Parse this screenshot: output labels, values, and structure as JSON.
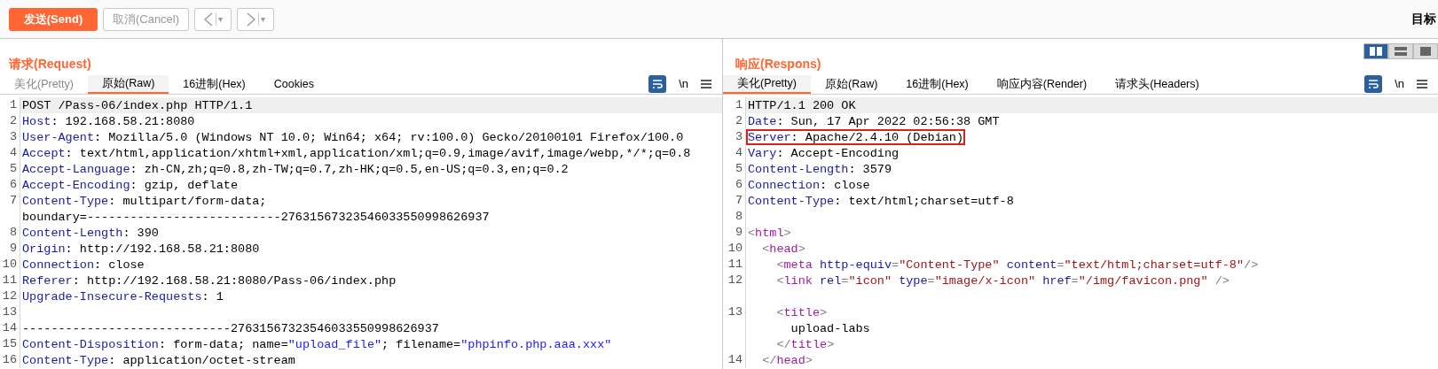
{
  "toolbar": {
    "send": "发送(Send)",
    "cancel": "取消(Cancel)",
    "back_caret": "▾",
    "forward_caret": "▾",
    "target": "目标"
  },
  "request": {
    "title": "请求(Request)",
    "tabs": [
      {
        "label": "美化(Pretty)",
        "selected": false,
        "disabled": true
      },
      {
        "label": "原始(Raw)",
        "selected": true,
        "disabled": false
      },
      {
        "label": "16进制(Hex)",
        "selected": false,
        "disabled": false
      },
      {
        "label": "Cookies",
        "selected": false,
        "disabled": false
      }
    ],
    "newline_toggle": "\\n",
    "lines": [
      {
        "number": "1",
        "current": true,
        "segments": [
          {
            "kind": "plain",
            "text": "POST /Pass-06/index.php HTTP/1.1"
          }
        ]
      },
      {
        "number": "2",
        "current": false,
        "segments": [
          {
            "kind": "key",
            "text": "Host"
          },
          {
            "kind": "plain",
            "text": ": 192.168.58.21:8080"
          }
        ]
      },
      {
        "number": "3",
        "current": false,
        "segments": [
          {
            "kind": "key",
            "text": "User-Agent"
          },
          {
            "kind": "plain",
            "text": ": Mozilla/5.0 (Windows NT 10.0; Win64; x64; rv:100.0) Gecko/20100101 Firefox/100.0"
          }
        ]
      },
      {
        "number": "4",
        "current": false,
        "segments": [
          {
            "kind": "key",
            "text": "Accept"
          },
          {
            "kind": "plain",
            "text": ": text/html,application/xhtml+xml,application/xml;q=0.9,image/avif,image/webp,*/*;q=0.8"
          }
        ]
      },
      {
        "number": "5",
        "current": false,
        "segments": [
          {
            "kind": "key",
            "text": "Accept-Language"
          },
          {
            "kind": "plain",
            "text": ": zh-CN,zh;q=0.8,zh-TW;q=0.7,zh-HK;q=0.5,en-US;q=0.3,en;q=0.2"
          }
        ]
      },
      {
        "number": "6",
        "current": false,
        "segments": [
          {
            "kind": "key",
            "text": "Accept-Encoding"
          },
          {
            "kind": "plain",
            "text": ": gzip, deflate"
          }
        ]
      },
      {
        "number": "7",
        "current": false,
        "segments": [
          {
            "kind": "key",
            "text": "Content-Type"
          },
          {
            "kind": "plain",
            "text": ": multipart/form-data;"
          }
        ]
      },
      {
        "current": false,
        "segments": [
          {
            "kind": "plain",
            "text": "boundary=---------------------------27631567323546033550998626937"
          }
        ]
      },
      {
        "number": "8",
        "current": false,
        "segments": [
          {
            "kind": "key",
            "text": "Content-Length"
          },
          {
            "kind": "plain",
            "text": ": 390"
          }
        ]
      },
      {
        "number": "9",
        "current": false,
        "segments": [
          {
            "kind": "key",
            "text": "Origin"
          },
          {
            "kind": "plain",
            "text": ": http://192.168.58.21:8080"
          }
        ]
      },
      {
        "number": "10",
        "current": false,
        "segments": [
          {
            "kind": "key",
            "text": "Connection"
          },
          {
            "kind": "plain",
            "text": ": close"
          }
        ]
      },
      {
        "number": "11",
        "current": false,
        "segments": [
          {
            "kind": "key",
            "text": "Referer"
          },
          {
            "kind": "plain",
            "text": ": http://192.168.58.21:8080/Pass-06/index.php"
          }
        ]
      },
      {
        "number": "12",
        "current": false,
        "segments": [
          {
            "kind": "key",
            "text": "Upgrade-Insecure-Requests"
          },
          {
            "kind": "plain",
            "text": ": 1"
          }
        ]
      },
      {
        "number": "13",
        "current": false
      },
      {
        "number": "14",
        "current": false,
        "segments": [
          {
            "kind": "plain",
            "text": "-----------------------------27631567323546033550998626937"
          }
        ]
      },
      {
        "number": "15",
        "current": false,
        "segments": [
          {
            "kind": "key",
            "text": "Content-Disposition"
          },
          {
            "kind": "plain",
            "text": ": form-data; name="
          },
          {
            "kind": "string",
            "text": "\"upload_file\""
          },
          {
            "kind": "plain",
            "text": "; filename="
          },
          {
            "kind": "string",
            "text": "\"phpinfo.php.aaa.xxx\""
          }
        ]
      },
      {
        "number": "16",
        "current": false,
        "segments": [
          {
            "kind": "key",
            "text": "Content-Type"
          },
          {
            "kind": "plain",
            "text": ": application/octet-stream"
          }
        ]
      }
    ]
  },
  "response": {
    "title": "响应(Respons)",
    "tabs": [
      {
        "label": "美化(Pretty)",
        "selected": true,
        "disabled": false
      },
      {
        "label": "原始(Raw)",
        "selected": false,
        "disabled": false
      },
      {
        "label": "16进制(Hex)",
        "selected": false,
        "disabled": false
      },
      {
        "label": "响应内容(Render)",
        "selected": false,
        "disabled": false
      },
      {
        "label": "请求头(Headers)",
        "selected": false,
        "disabled": false
      }
    ],
    "newline_toggle": "\\n",
    "layout_buttons": [
      {
        "kind": "columns",
        "selected": true
      },
      {
        "kind": "rows",
        "selected": false
      },
      {
        "kind": "single",
        "selected": false
      }
    ],
    "lines": [
      {
        "number": "1",
        "current": true,
        "highlighted": false,
        "segments": [
          {
            "kind": "plain",
            "text": "HTTP/1.1 200 OK"
          }
        ]
      },
      {
        "number": "2",
        "current": false,
        "highlighted": false,
        "segments": [
          {
            "kind": "key",
            "text": "Date"
          },
          {
            "kind": "plain",
            "text": ": Sun, 17 Apr 2022 02:56:38 GMT"
          }
        ]
      },
      {
        "number": "3",
        "current": false,
        "highlighted": true,
        "segments": [
          {
            "kind": "key",
            "text": "Server"
          },
          {
            "kind": "plain",
            "text": ": Apache/2.4.10 (Debian)"
          }
        ]
      },
      {
        "number": "4",
        "current": false,
        "highlighted": false,
        "segments": [
          {
            "kind": "key",
            "text": "Vary"
          },
          {
            "kind": "plain",
            "text": ": Accept-Encoding"
          }
        ]
      },
      {
        "number": "5",
        "current": false,
        "highlighted": false,
        "segments": [
          {
            "kind": "key",
            "text": "Content-Length"
          },
          {
            "kind": "plain",
            "text": ": 3579"
          }
        ]
      },
      {
        "number": "6",
        "current": false,
        "highlighted": false,
        "segments": [
          {
            "kind": "key",
            "text": "Connection"
          },
          {
            "kind": "plain",
            "text": ": close"
          }
        ]
      },
      {
        "number": "7",
        "current": false,
        "highlighted": false,
        "segments": [
          {
            "kind": "key",
            "text": "Content-Type"
          },
          {
            "kind": "plain",
            "text": ": text/html;charset=utf-8"
          }
        ]
      },
      {
        "number": "8",
        "current": false
      },
      {
        "number": "9",
        "current": false,
        "highlighted": false,
        "segments": [
          {
            "kind": "punct",
            "text": "<"
          },
          {
            "kind": "tag",
            "text": "html"
          },
          {
            "kind": "punct",
            "text": ">"
          }
        ]
      },
      {
        "number": "10",
        "current": false,
        "highlighted": false,
        "segments": [
          {
            "kind": "punct",
            "text": "  <"
          },
          {
            "kind": "tag",
            "text": "head"
          },
          {
            "kind": "punct",
            "text": ">"
          }
        ]
      },
      {
        "number": "11",
        "current": false,
        "highlighted": false,
        "segments": [
          {
            "kind": "punct",
            "text": "    <"
          },
          {
            "kind": "tag",
            "text": "meta"
          },
          {
            "kind": "attr",
            "text": " http-equiv"
          },
          {
            "kind": "punct",
            "text": "="
          },
          {
            "kind": "value",
            "text": "\"Content-Type\""
          },
          {
            "kind": "attr",
            "text": " content"
          },
          {
            "kind": "punct",
            "text": "="
          },
          {
            "kind": "value",
            "text": "\"text/html;charset=utf-8\""
          },
          {
            "kind": "punct",
            "text": "/>"
          }
        ]
      },
      {
        "number": "12",
        "current": false,
        "highlighted": false,
        "segments": [
          {
            "kind": "punct",
            "text": "    <"
          },
          {
            "kind": "tag",
            "text": "link"
          },
          {
            "kind": "attr",
            "text": " rel"
          },
          {
            "kind": "punct",
            "text": "="
          },
          {
            "kind": "value",
            "text": "\"icon\""
          },
          {
            "kind": "attr",
            "text": " type"
          },
          {
            "kind": "punct",
            "text": "="
          },
          {
            "kind": "value",
            "text": "\"image/x-icon\""
          },
          {
            "kind": "attr",
            "text": " href"
          },
          {
            "kind": "punct",
            "text": "="
          },
          {
            "kind": "value",
            "text": "\"/img/favicon.png\""
          },
          {
            "kind": "punct",
            "text": " />"
          }
        ]
      },
      {
        "current": false
      },
      {
        "number": "13",
        "current": false,
        "highlighted": false,
        "segments": [
          {
            "kind": "punct",
            "text": "    <"
          },
          {
            "kind": "tag",
            "text": "title"
          },
          {
            "kind": "punct",
            "text": ">"
          }
        ]
      },
      {
        "current": false,
        "highlighted": false,
        "segments": [
          {
            "kind": "plain",
            "text": "      upload-labs"
          }
        ]
      },
      {
        "current": false,
        "highlighted": false,
        "segments": [
          {
            "kind": "punct",
            "text": "    </"
          },
          {
            "kind": "tag",
            "text": "title"
          },
          {
            "kind": "punct",
            "text": ">"
          }
        ]
      },
      {
        "number": "14",
        "current": false,
        "highlighted": false,
        "segments": [
          {
            "kind": "punct",
            "text": "  </"
          },
          {
            "kind": "tag",
            "text": "head"
          },
          {
            "kind": "punct",
            "text": ">"
          }
        ]
      }
    ]
  }
}
